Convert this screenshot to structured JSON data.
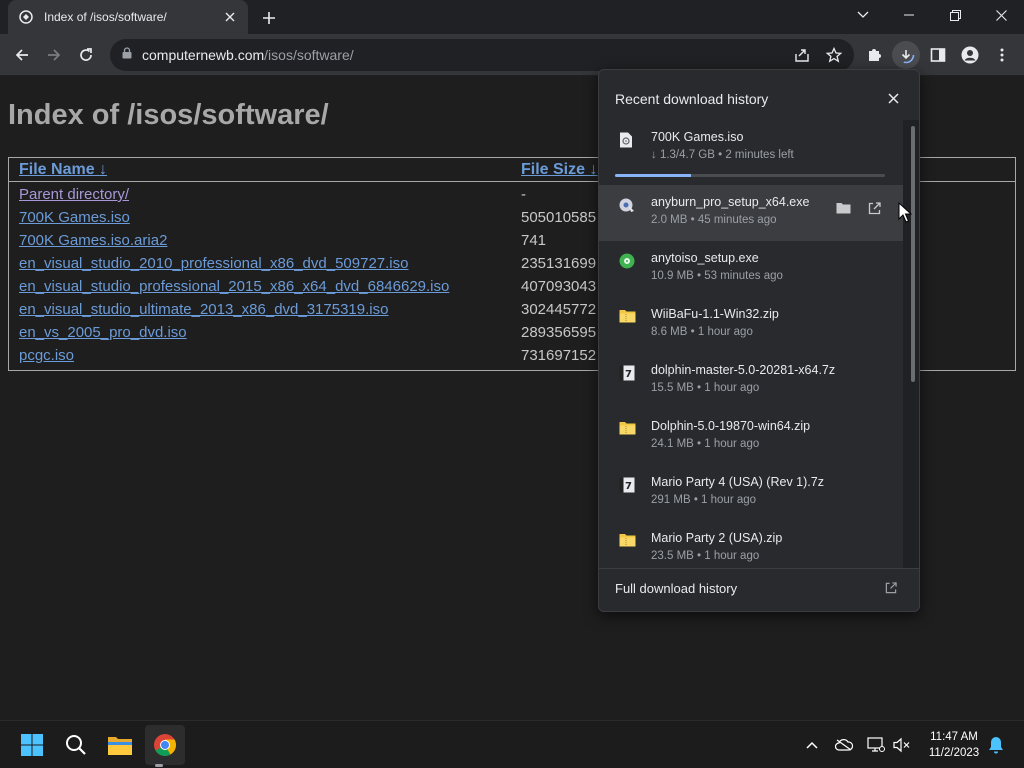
{
  "browser": {
    "tab_title": "Index of /isos/software/",
    "url_host": "computernewb.com",
    "url_path": "/isos/software/"
  },
  "page": {
    "heading": "Index of /isos/software/",
    "columns": {
      "name": "File Name",
      "name_sort": "↓",
      "size": "File Size",
      "size_sort": "↓"
    },
    "rows": [
      {
        "name": "Parent directory/",
        "size": "-",
        "visited": true
      },
      {
        "name": "700K Games.iso",
        "size": "505010585",
        "visited": false
      },
      {
        "name": "700K Games.iso.aria2",
        "size": "741",
        "visited": false
      },
      {
        "name": "en_visual_studio_2010_professional_x86_dvd_509727.iso",
        "size": "235131699",
        "visited": false
      },
      {
        "name": "en_visual_studio_professional_2015_x86_x64_dvd_6846629.iso",
        "size": "407093043",
        "visited": false
      },
      {
        "name": "en_visual_studio_ultimate_2013_x86_dvd_3175319.iso",
        "size": "302445772",
        "visited": false
      },
      {
        "name": "en_vs_2005_pro_dvd.iso",
        "size": "289356595",
        "visited": false
      },
      {
        "name": "pcgc.iso",
        "size": "731697152",
        "visited": false
      }
    ]
  },
  "downloads": {
    "title": "Recent download history",
    "footer": "Full download history",
    "progress_fraction": 0.28,
    "items": [
      {
        "name": "700K Games.iso",
        "meta": "↓ 1.3/4.7 GB • 2 minutes left",
        "icon": "iso-file-icon",
        "in_progress": true
      },
      {
        "name": "anyburn_pro_setup_x64.exe",
        "meta": "2.0 MB • 45 minutes ago",
        "icon": "exe-installer-icon",
        "hover": true
      },
      {
        "name": "anytoiso_setup.exe",
        "meta": "10.9 MB • 53 minutes ago",
        "icon": "exe-green-icon"
      },
      {
        "name": "WiiBaFu-1.1-Win32.zip",
        "meta": "8.6 MB • 1 hour ago",
        "icon": "zip-folder-icon"
      },
      {
        "name": "dolphin-master-5.0-20281-x64.7z",
        "meta": "15.5 MB • 1 hour ago",
        "icon": "7z-archive-icon"
      },
      {
        "name": "Dolphin-5.0-19870-win64.zip",
        "meta": "24.1 MB • 1 hour ago",
        "icon": "zip-folder-icon"
      },
      {
        "name": "Mario Party 4 (USA) (Rev 1).7z",
        "meta": "291 MB • 1 hour ago",
        "icon": "7z-archive-icon"
      },
      {
        "name": "Mario Party 2 (USA).zip",
        "meta": "23.5 MB • 1 hour ago",
        "icon": "zip-folder-icon"
      }
    ]
  },
  "taskbar": {
    "time": "11:47 AM",
    "date": "11/2/2023"
  },
  "colors": {
    "link": "#6b9bd8",
    "visited": "#a998d8",
    "accent": "#8ab4f8"
  }
}
